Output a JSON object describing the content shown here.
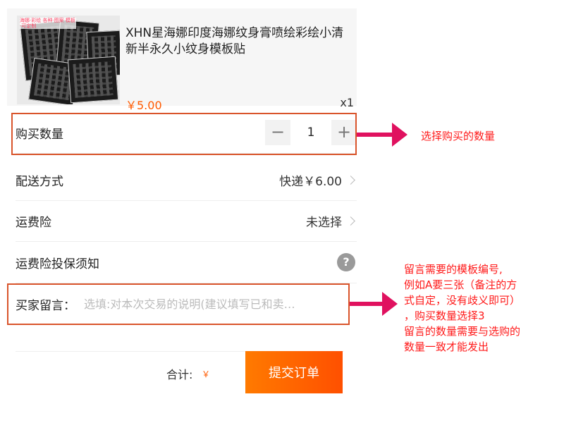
{
  "product": {
    "title": "XHN星海娜印度海娜纹身膏喷绘彩绘小清新半永久小纹身模板贴",
    "price": "￥5.00",
    "quantity_label": "x1",
    "thumb_caption": "海娜·彩绘 各种·图案 模板·可定制"
  },
  "rows": {
    "quantity": {
      "label": "购买数量",
      "minus": "−",
      "value": "1",
      "plus": "+"
    },
    "delivery": {
      "label": "配送方式",
      "value": "快递￥6.00"
    },
    "insurance": {
      "label": "运费险",
      "value": "未选择"
    },
    "insurance_notice": {
      "label": "运费险投保须知",
      "help": "?"
    },
    "message": {
      "label": "买家留言：",
      "placeholder": "选填:对本次交易的说明(建议填写已和卖…"
    }
  },
  "footer": {
    "total_label": "合计:",
    "total_currency": "￥",
    "submit_label": "提交订单"
  },
  "annotations": {
    "quantity_note": "选择购买的数量",
    "message_note": [
      "留言需要的模板编号,",
      "例如A要三张（备注的方",
      "式自定，没有歧义即可）",
      "，购买数量选择3",
      "留言的数量需要与选购的",
      "数量一致才能发出"
    ]
  },
  "colors": {
    "accent": "#ff5a00",
    "annotation_red": "#ff1a1a",
    "arrow": "#e0115f",
    "box": "#d9542b"
  }
}
